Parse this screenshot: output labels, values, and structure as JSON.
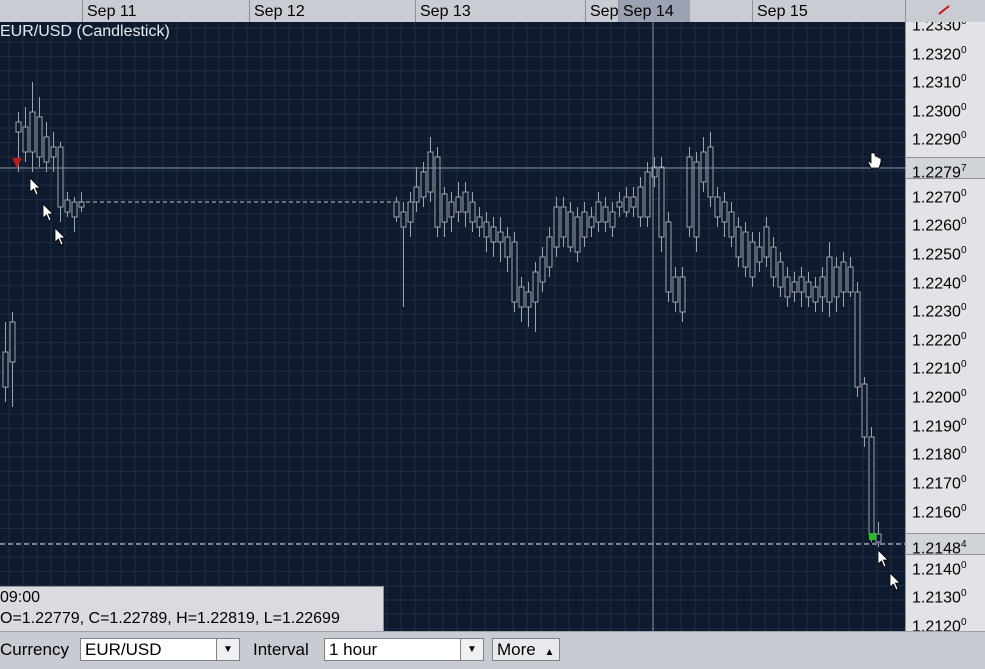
{
  "top_axis": {
    "dates": [
      {
        "label": "Sep 11"
      },
      {
        "label": "Sep 12"
      },
      {
        "label": "Sep 13"
      },
      {
        "label": "Sep"
      },
      {
        "label": "Sep 14",
        "active": true
      },
      {
        "label": "Sep 15"
      }
    ]
  },
  "chart": {
    "title": "EUR/USD (Candlestick)"
  },
  "price_axis": {
    "labels": [
      "1.2330",
      "1.2320",
      "1.2310",
      "1.2300",
      "1.2290",
      "1.2270",
      "1.2260",
      "1.2250",
      "1.2240",
      "1.2230",
      "1.2220",
      "1.2210",
      "1.2200",
      "1.2190",
      "1.2180",
      "1.2170",
      "1.2160",
      "1.2140",
      "1.2130",
      "1.2120"
    ],
    "superscript": "0",
    "crosshair_price": {
      "main": "1.2279",
      "sup": "7"
    },
    "last_price": {
      "main": "1.2148",
      "sup": "4"
    }
  },
  "info_box": {
    "time": "09:00",
    "ohlc": "O=1.22779, C=1.22789, H=1.22819, L=1.22699"
  },
  "toolbar": {
    "currency_label": "Currency",
    "currency_value": "EUR/USD",
    "interval_label": "Interval",
    "interval_value": "1 hour",
    "more_label": "More"
  },
  "colors": {
    "chart_bg": "#0e1a2d",
    "grid": "#1f2d44",
    "candle": "#9fa3aa",
    "buy_marker": "#20c020",
    "sell_marker": "#c01818"
  },
  "cursor_icons": [
    "hand-cursor-icon",
    "arrow-cursor-icon"
  ]
}
